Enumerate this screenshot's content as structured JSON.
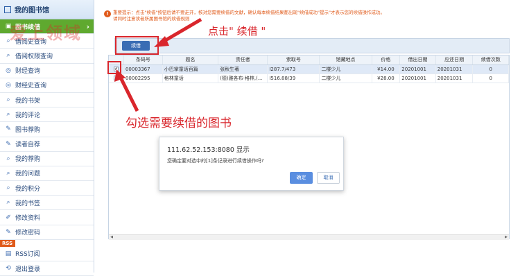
{
  "sidebar": {
    "title": "我的图书馆",
    "items": [
      {
        "label": "图书续借",
        "icon": "renew-icon",
        "active": true
      },
      {
        "label": "借阅史查询",
        "icon": "search-icon"
      },
      {
        "label": "借阅权限查询",
        "icon": "search-icon"
      },
      {
        "label": "财经查询",
        "icon": "finance-icon"
      },
      {
        "label": "财经史查询",
        "icon": "finance-icon"
      },
      {
        "label": "我的书架",
        "icon": "search-icon"
      },
      {
        "label": "我的评论",
        "icon": "search-icon"
      },
      {
        "label": "图书荐购",
        "icon": "edit-icon"
      },
      {
        "label": "读者自荐",
        "icon": "edit-icon"
      },
      {
        "label": "我的荐购",
        "icon": "search-icon"
      },
      {
        "label": "我的问题",
        "icon": "search-icon"
      },
      {
        "label": "我的积分",
        "icon": "search-icon"
      },
      {
        "label": "我的书签",
        "icon": "search-icon"
      },
      {
        "label": "修改资料",
        "icon": "pen-icon"
      },
      {
        "label": "修改密码",
        "icon": "edit-icon"
      }
    ],
    "rss_badge": "RSS",
    "rss_item": "RSS订阅",
    "logout": "退出登录"
  },
  "notice": {
    "line1": "重要提示：点击\"续借\"按钮后请不要走开，核对您需要续借的文献，确认每本续借结果都出现\"续借成功\"提示\"才表示您的续借操作成功。",
    "line2": "请同时注意读者所属图书馆的续借规则"
  },
  "toolbar": {
    "renew_label": "续借"
  },
  "table": {
    "headers": [
      "",
      "条码号",
      "题名",
      "责任者",
      "索取号",
      "馆藏地点",
      "价格",
      "借出日期",
      "应还日期",
      "续借次数"
    ],
    "rows": [
      {
        "checked": true,
        "barcode": "00003367",
        "title": "小巴掌童话百篇",
        "author": "张秋生著",
        "callno": "I287.7/473",
        "location": "二楼少儿",
        "price": "¥14.00",
        "loan": "20201001",
        "due": "20201031",
        "renewals": "0"
      },
      {
        "checked": false,
        "barcode": "00002295",
        "title": "格林童话",
        "author": "(德)雅各布·格林,(...",
        "callno": "I516.88/39",
        "location": "二楼少儿",
        "price": "¥28.00",
        "loan": "20201001",
        "due": "20201031",
        "renewals": "0"
      }
    ]
  },
  "annotations": {
    "click_renew": "点击\" 续借 \"",
    "check_books": "勾选需要续借的图书"
  },
  "watermark": "爱上领域",
  "dialog": {
    "title": "111.62.52.153:8080 显示",
    "message": "您确定要对选中的[1]条记录进行续借操作吗?",
    "ok": "确定",
    "cancel": "取消"
  }
}
